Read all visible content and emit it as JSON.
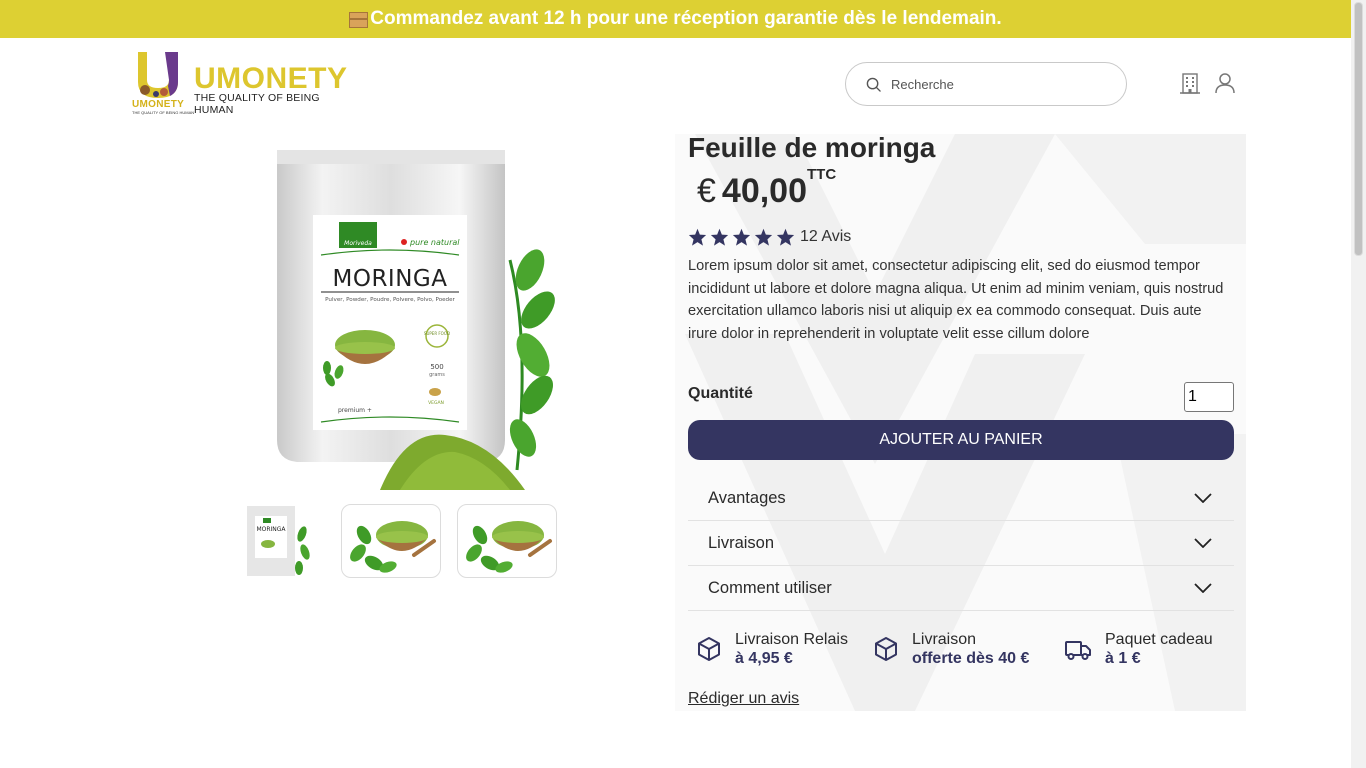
{
  "banner": {
    "text": "Commandez avant 12 h pour une réception garantie dès le lendemain."
  },
  "logo": {
    "name": "UMONETY",
    "tagline": "THE QUALITY OF BEING HUMAN",
    "small_name": "UMONETY",
    "small_tagline": "THE QUALITY OF BEING HUMAN"
  },
  "header": {
    "search_placeholder": "Recherche"
  },
  "package": {
    "brand": "Moriveda",
    "claim": "pure natural",
    "name": "MORINGA",
    "languages": "Pulver, Powder, Poudre, Polvere, Polvo, Poeder",
    "badge": "SUPER FOOD",
    "weight": "500",
    "weight_unit": "grams",
    "grade": "premium +",
    "vegan": "VEGAN"
  },
  "product": {
    "title": "Feuille de moringa",
    "currency": "€",
    "price": "40,00",
    "price_suffix": "TTC",
    "rating": 5,
    "reviews": "12 Avis",
    "description": "Lorem ipsum dolor sit amet, consectetur adipiscing elit, sed do eiusmod tempor incididunt ut labore et dolore magna aliqua. Ut enim ad minim veniam, quis nostrud exercitation ullamco laboris nisi ut aliquip ex ea commodo consequat. Duis aute irure dolor in reprehenderit in voluptate velit esse cillum dolore",
    "quantity_label": "Quantité",
    "quantity_value": "1",
    "add_to_cart": "AJOUTER AU PANIER",
    "accordion": [
      "Avantages",
      "Livraison",
      "Comment utiliser"
    ],
    "features": [
      {
        "icon": "box-icon",
        "line1": "Livraison Relais",
        "line2": "à 4,95 €"
      },
      {
        "icon": "box-icon",
        "line1": "Livraison",
        "line2": "offerte dès 40 €"
      },
      {
        "icon": "truck-icon",
        "line1": "Paquet cadeau",
        "line2": "à 1 €"
      }
    ],
    "review_link": "Rédiger un avis"
  },
  "colors": {
    "banner": "#ddd033",
    "brand_yellow": "#ddc62e",
    "navy": "#343561",
    "purple": "#6a3a8c"
  }
}
